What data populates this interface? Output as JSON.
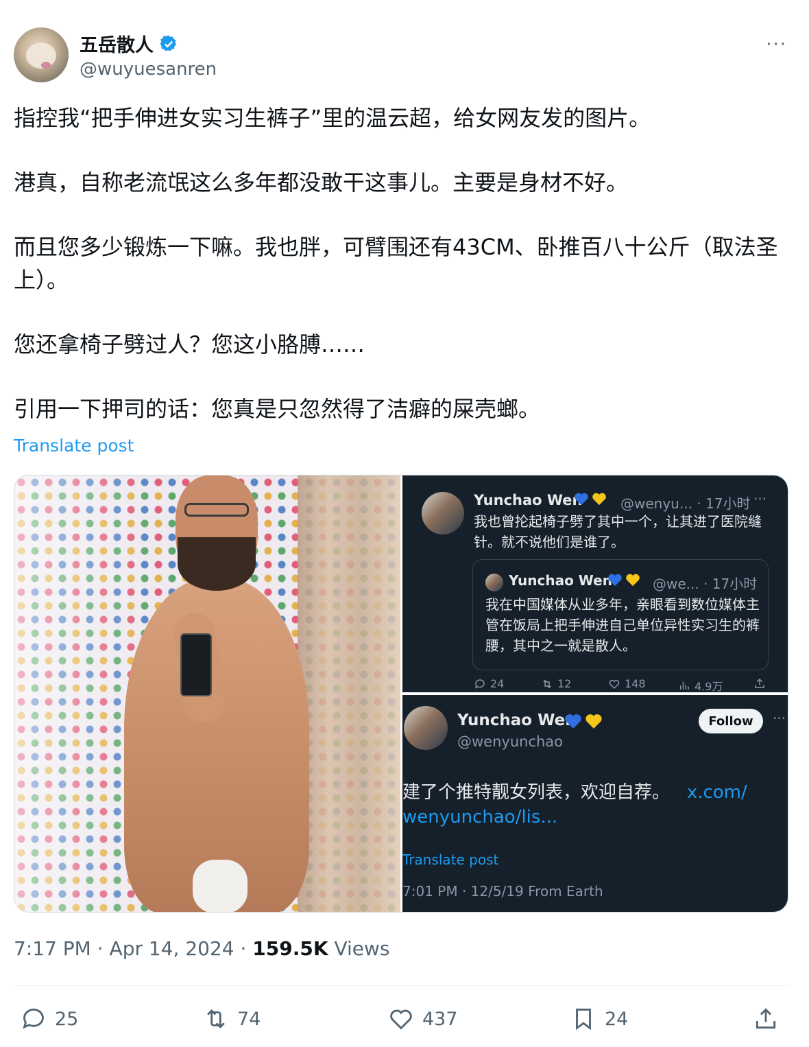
{
  "author": {
    "display_name": "五岳散人",
    "handle": "@wuyuesanren"
  },
  "header": {
    "more_label": "···"
  },
  "post": {
    "paragraphs": [
      "指控我“把手伸进女实习生裤子”里的温云超，给女网友发的图片。",
      "港真，自称老流氓这么多年都没敢干这事儿。主要是身材不好。",
      "而且您多少锻炼一下嘛。我也胖，可臂围还有43CM、卧推百八十公斤（取法圣上）。",
      "您还拿椅子劈过人？您这小胳膊……",
      "引用一下押司的话：您真是只忽然得了洁癖的屎壳螂。"
    ],
    "translate_label": "Translate post"
  },
  "shot1": {
    "name": "Yunchao Wen",
    "meta": "@wenyu... · 17小时",
    "more": "···",
    "text": "我也曾抡起椅子劈了其中一个，让其进了医院缝针。就不说他们是谁了。",
    "quote": {
      "name": "Yunchao Wen",
      "meta": "@we... · 17小时",
      "text": "我在中国媒体从业多年，亲眼看到数位媒体主管在饭局上把手伸进自己单位异性实习生的裤腰，其中之一就是散人。"
    },
    "actions": {
      "replies": "24",
      "reposts": "12",
      "likes": "148",
      "views": "4.9万"
    }
  },
  "shot2": {
    "name": "Yunchao Wen",
    "handle": "@wenyunchao",
    "follow_label": "Follow",
    "more": "···",
    "text": "建了个推特靓女列表，欢迎自荐。",
    "link_1": "x.com/",
    "link_2": "wenyunchao/lis...",
    "translate_label": "Translate post",
    "timestamp": "7:01 PM · 12/5/19 From Earth"
  },
  "meta": {
    "time": "7:17 PM",
    "date": "Apr 14, 2024",
    "views_count": "159.5K",
    "views_label": "Views",
    "dot": "·"
  },
  "actions": {
    "replies": "25",
    "reposts": "74",
    "likes": "437",
    "bookmarks": "24"
  },
  "colors": {
    "accent": "#1d9bf0",
    "dark_bg": "#15202b",
    "muted": "#536471",
    "verified": "#1d9bf0",
    "heart_blue": "#2f6fe0",
    "heart_yellow": "#f5c518"
  },
  "icons": [
    "verified-badge-icon",
    "more-icon",
    "reply-icon",
    "repost-icon",
    "like-icon",
    "views-icon",
    "bookmark-icon",
    "share-icon",
    "blue-heart-icon",
    "yellow-heart-icon"
  ]
}
